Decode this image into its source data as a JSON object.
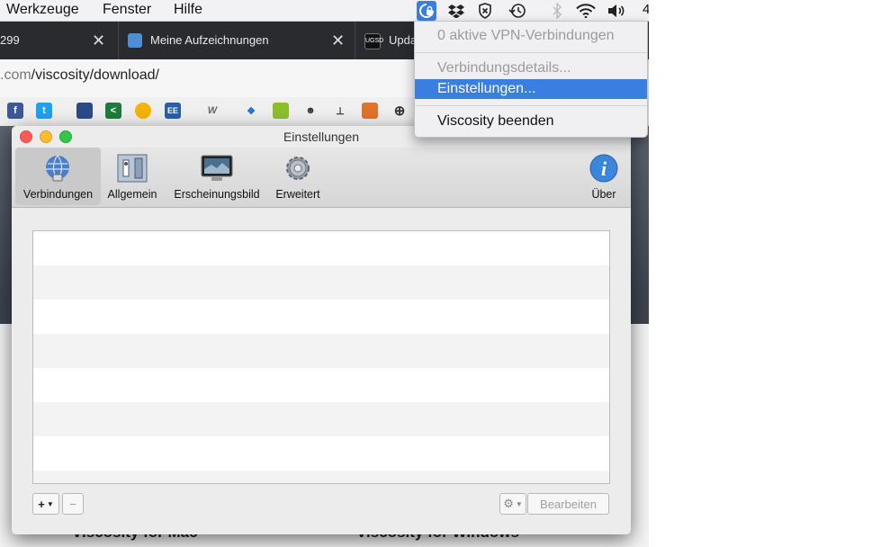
{
  "menubar": {
    "items": [
      "Werkzeuge",
      "Fenster",
      "Hilfe"
    ],
    "clock_fragment": "4"
  },
  "tabs": [
    {
      "label": "299"
    },
    {
      "label": "Meine Aufzeichnungen"
    },
    {
      "label": "Upda"
    }
  ],
  "url": {
    "host": ".com",
    "path": "/viscosity/download/"
  },
  "page": {
    "heading_mac": "Viscosity for Mac",
    "heading_windows": "Viscosity for Windows"
  },
  "window": {
    "title": "Einstellungen",
    "toolbar": [
      {
        "label": "Verbindungen",
        "icon": "globe-network-icon"
      },
      {
        "label": "Allgemein",
        "icon": "switch-panel-icon"
      },
      {
        "label": "Erscheinungsbild",
        "icon": "monitor-icon"
      },
      {
        "label": "Erweitert",
        "icon": "gear-icon"
      },
      {
        "label": "Über",
        "icon": "info-icon"
      }
    ],
    "footer": {
      "add": "+",
      "remove": "−",
      "edit": "Bearbeiten"
    }
  },
  "dropdown": {
    "status": "0 aktive VPN-Verbindungen",
    "details": "Verbindungsdetails...",
    "settings": "Einstellungen...",
    "quit": "Viscosity beenden"
  },
  "colors": {
    "highlight": "#3a7ee2",
    "tabbar": "#2a2b2e"
  }
}
